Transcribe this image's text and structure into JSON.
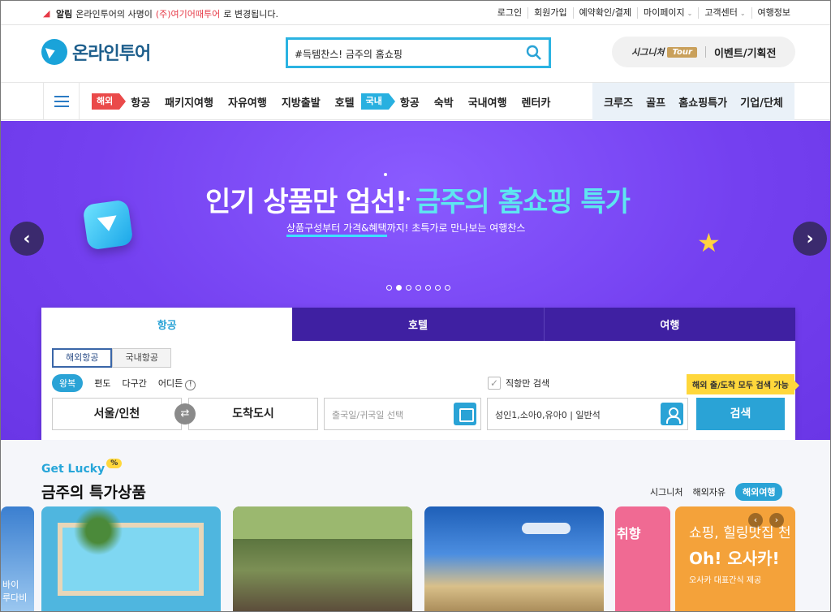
{
  "notice": {
    "label": "알림",
    "text_before": "온라인투어의 사명이",
    "highlight": "(주)여기어때투어",
    "text_after": "로 변경됩니다."
  },
  "top_links": [
    "로그인",
    "회원가입",
    "예약확인/결제",
    "마이페이지",
    "고객센터",
    "여행정보"
  ],
  "logo": {
    "text": "온라인투어"
  },
  "search": {
    "value": "#득템찬스! 금주의 홈쇼핑"
  },
  "signature": {
    "label": "시그니처",
    "tour": "Tour",
    "events": "이벤트/기획전"
  },
  "nav": {
    "overseas_tag": "해외",
    "overseas": [
      "항공",
      "패키지여행",
      "자유여행",
      "지방출발",
      "호텔"
    ],
    "domestic_tag": "국내",
    "domestic": [
      "항공",
      "숙박",
      "국내여행",
      "렌터카"
    ],
    "right": [
      "크루즈",
      "골프",
      "홈쇼핑특가",
      "기업/단체"
    ]
  },
  "banner": {
    "title_white": "인기 상품만 엄선!",
    "title_accent": "금주의 홈쇼핑 특가",
    "sub_underlined": "상품구성부터 가격&혜택",
    "sub_rest": "까지! 초특가로 만나보는 여행찬스",
    "slides": 7,
    "active_slide": 2
  },
  "booking": {
    "tabs": [
      "항공",
      "호텔",
      "여행"
    ],
    "segments": [
      "해외항공",
      "국내항공"
    ],
    "trip_types": [
      "왕복",
      "편도",
      "다구간",
      "어디든"
    ],
    "direct_only": "직항만 검색",
    "tip": "해외 출/도착 모두 검색 가능",
    "from": "서울/인천",
    "to": "도착도시",
    "date_placeholder": "출국일/귀국일 선택",
    "pax": "성인1,소아0,유아0 | 일반석",
    "search_button": "검색"
  },
  "deals": {
    "kicker": "Get Lucky",
    "kicker_badge": "%",
    "title": "금주의 특가상품",
    "tabs": [
      "시그니처",
      "해외자유",
      "해외여행"
    ],
    "active_tab": "해외여행",
    "card0_lines": [
      "바이",
      "루다비"
    ],
    "card4_text": "취향",
    "card5": {
      "line1": "쇼핑, 힐링맛집 천",
      "line2": "Oh! 오사카!",
      "line3": "오사카 대표간식 제공"
    }
  },
  "colors": {
    "brand": "#2aa3d6",
    "banner": "#7440f0",
    "booking_tab": "#3f20a2",
    "accent_text": "#5ee6f0",
    "tip": "#ffd73b",
    "alert": "#e63946"
  }
}
